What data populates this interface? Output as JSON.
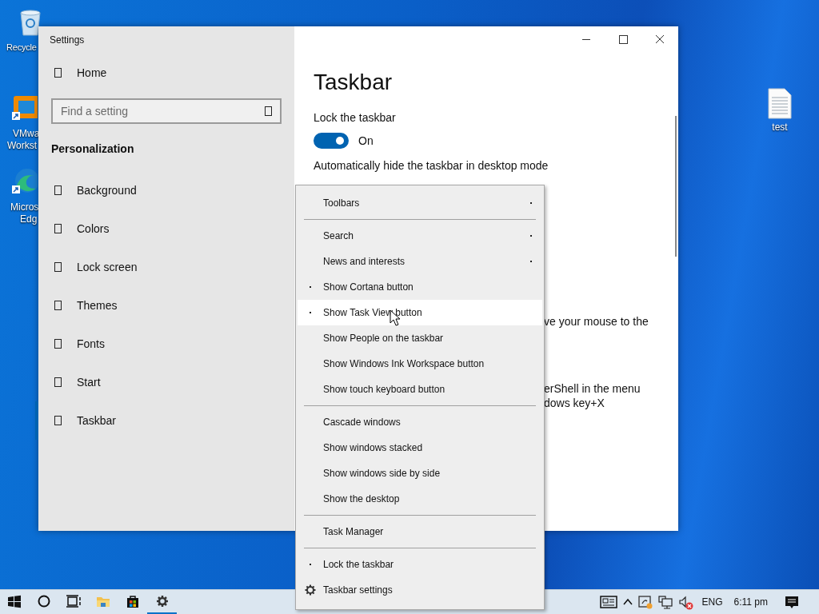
{
  "desktop": {
    "icons": [
      {
        "kind": "recycle-bin",
        "label": [
          "Recycle"
        ]
      },
      {
        "kind": "vm-app",
        "label": [
          "VMwa",
          "Workst"
        ]
      },
      {
        "kind": "browser",
        "label": [
          "Micros",
          "Edg"
        ]
      },
      {
        "kind": "text-file",
        "label": [
          "test"
        ]
      }
    ]
  },
  "settings_window": {
    "title": "Settings",
    "sidebar": {
      "home": "Home",
      "search": {
        "placeholder": "Find a setting"
      },
      "section": "Personalization",
      "items": [
        {
          "label": "Background",
          "selected": false
        },
        {
          "label": "Colors",
          "selected": false
        },
        {
          "label": "Lock screen",
          "selected": false
        },
        {
          "label": "Themes",
          "selected": false
        },
        {
          "label": "Fonts",
          "selected": false
        },
        {
          "label": "Start",
          "selected": false
        },
        {
          "label": "Taskbar",
          "selected": true
        }
      ]
    },
    "page": {
      "heading": "Taskbar",
      "settings": [
        {
          "label": "Lock the taskbar",
          "on": true,
          "state_text": "On"
        },
        {
          "label": "Automatically hide the taskbar in desktop mode"
        }
      ],
      "obscured_groups": [
        {
          "lines": [
            "ve your mouse to the"
          ]
        },
        {
          "lines": [
            "erShell in the menu",
            "dows key+X"
          ]
        }
      ]
    }
  },
  "context_menu": {
    "items": [
      {
        "kind": "submenu",
        "label": "Toolbars",
        "hovered": false
      },
      {
        "kind": "separator"
      },
      {
        "kind": "submenu",
        "label": "Search",
        "hovered": false
      },
      {
        "kind": "submenu",
        "label": "News and interests",
        "hovered": false
      },
      {
        "kind": "item",
        "label": "Show Cortana button",
        "checked": true,
        "hovered": false
      },
      {
        "kind": "item",
        "label": "Show Task View button",
        "checked": true,
        "hovered": true
      },
      {
        "kind": "item",
        "label": "Show People on the taskbar",
        "checked": false,
        "hovered": false
      },
      {
        "kind": "item",
        "label": "Show Windows Ink Workspace button",
        "checked": false,
        "hovered": false
      },
      {
        "kind": "item",
        "label": "Show touch keyboard button",
        "checked": false,
        "hovered": false
      },
      {
        "kind": "separator"
      },
      {
        "kind": "item",
        "label": "Cascade windows",
        "checked": false,
        "hovered": false
      },
      {
        "kind": "item",
        "label": "Show windows stacked",
        "checked": false,
        "hovered": false
      },
      {
        "kind": "item",
        "label": "Show windows side by side",
        "checked": false,
        "hovered": false
      },
      {
        "kind": "item",
        "label": "Show the desktop",
        "checked": false,
        "hovered": false
      },
      {
        "kind": "separator"
      },
      {
        "kind": "item",
        "label": "Task Manager",
        "checked": false,
        "hovered": false
      },
      {
        "kind": "separator"
      },
      {
        "kind": "item",
        "label": "Lock the taskbar",
        "checked": true,
        "hovered": false
      },
      {
        "kind": "settings",
        "label": "Taskbar settings",
        "hovered": false
      }
    ]
  },
  "taskbar": {
    "apps": [
      {
        "kind": "start",
        "active": false
      },
      {
        "kind": "search",
        "active": false
      },
      {
        "kind": "task-view",
        "active": false
      },
      {
        "kind": "explorer",
        "active": false
      },
      {
        "kind": "store",
        "active": false
      },
      {
        "kind": "settings",
        "active": true
      }
    ],
    "tray": [
      {
        "kind": "news"
      },
      {
        "kind": "chevron"
      },
      {
        "kind": "sync"
      },
      {
        "kind": "network"
      },
      {
        "kind": "volume-muted"
      }
    ],
    "language": "ENG",
    "clock": "6:11 pm"
  }
}
